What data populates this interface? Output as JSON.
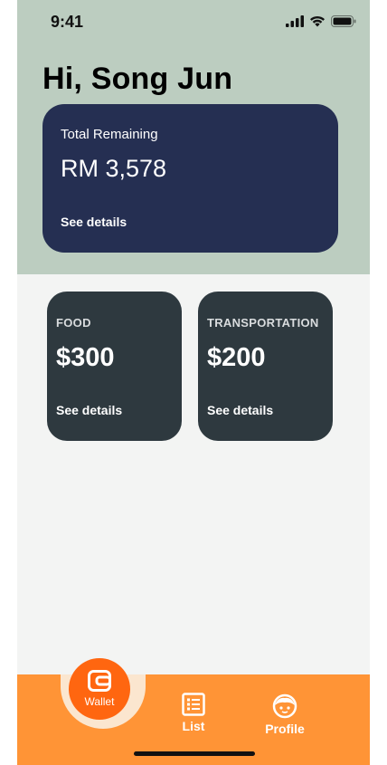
{
  "status_bar": {
    "time": "9:41"
  },
  "greeting": "Hi,  Song Jun",
  "summary": {
    "label": "Total Remaining",
    "amount": "RM 3,578",
    "link": "See details"
  },
  "categories": [
    {
      "name": "FOOD",
      "amount": "$300",
      "link": "See details"
    },
    {
      "name": "TRANSPORTATION",
      "amount": "$200",
      "link": "See details"
    }
  ],
  "nav": {
    "wallet": "Wallet",
    "list": "List",
    "profile": "Profile"
  },
  "colors": {
    "header_bg": "#bccdc0",
    "summary_card": "#252f52",
    "category_card": "#2e393f",
    "nav_bg": "#ff9436",
    "active_tab": "#ff6610"
  }
}
